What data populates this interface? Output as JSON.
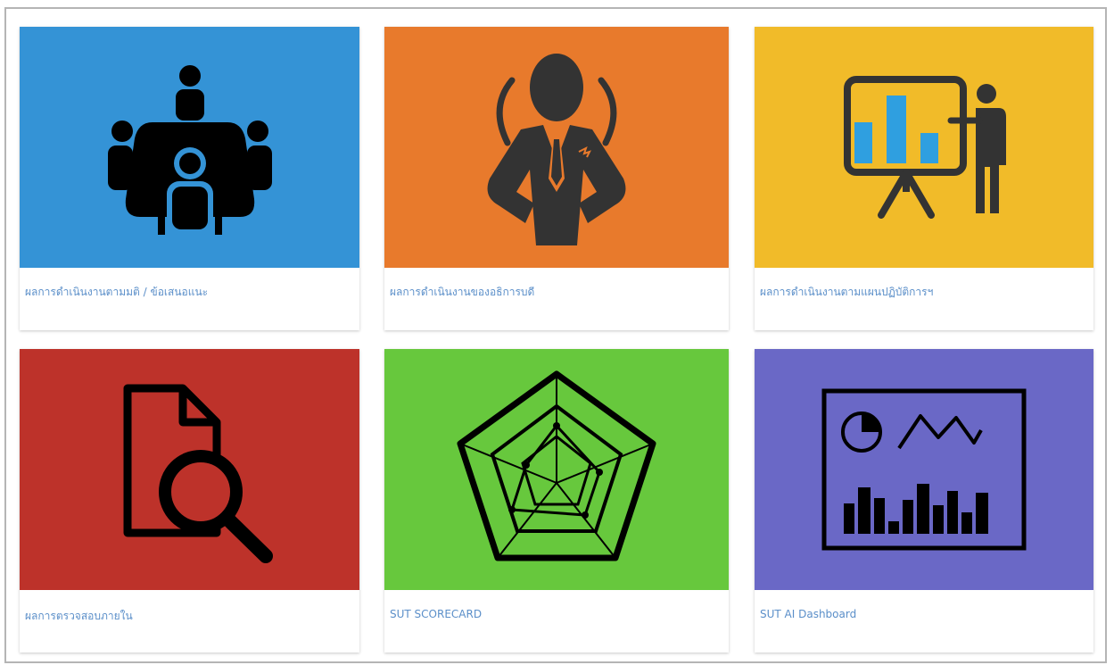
{
  "colors": {
    "blue": "#3493d6",
    "orange": "#e87a2c",
    "yellow": "#f1bb29",
    "red": "#bd322a",
    "green": "#67c83d",
    "purple": "#6a68c6",
    "link": "#5b8fc9"
  },
  "cards": [
    {
      "label": "ผลการดำเนินงานตามมติ / ข้อเสนอแนะ",
      "icon": "meeting-table-icon"
    },
    {
      "label": "ผลการดำเนินงานของอธิการบดี",
      "icon": "businessman-icon"
    },
    {
      "label": "ผลการดำเนินงานตามแผนปฏิบัติการฯ",
      "icon": "presentation-chart-icon"
    },
    {
      "label": "ผลการตรวจสอบภายใน",
      "icon": "document-search-icon"
    },
    {
      "label": "SUT SCORECARD",
      "icon": "radar-chart-icon"
    },
    {
      "label": "SUT AI Dashboard",
      "icon": "dashboard-monitor-icon"
    }
  ]
}
